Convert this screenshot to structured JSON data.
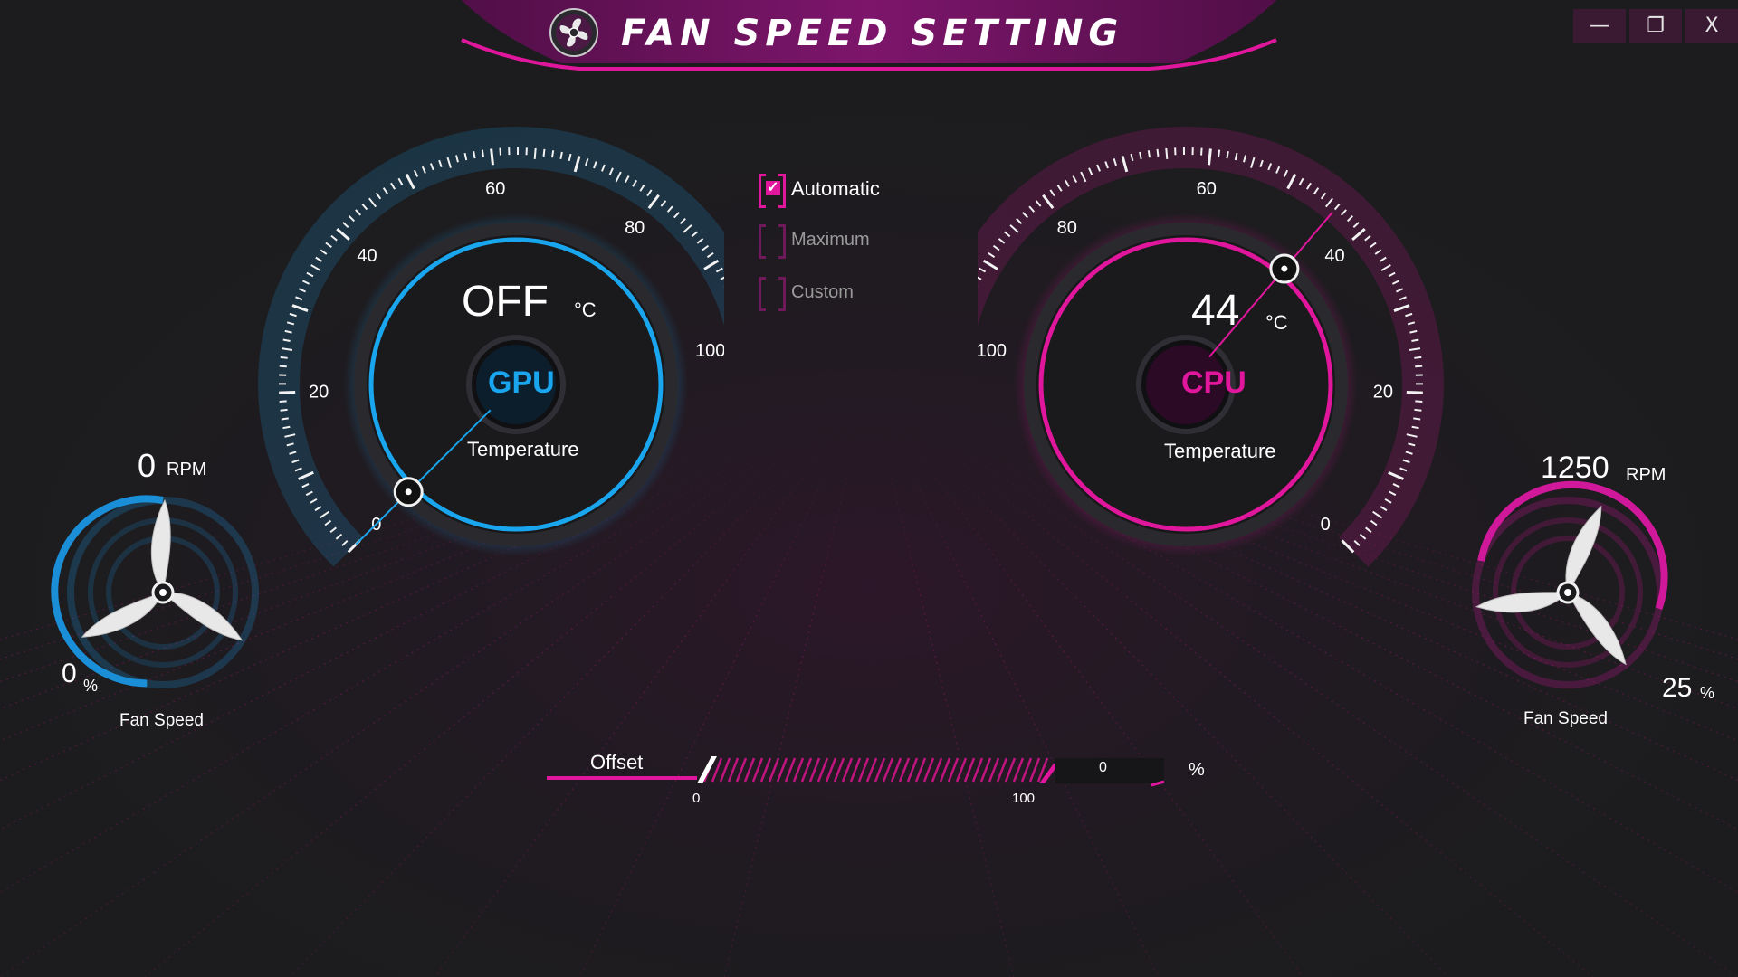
{
  "window": {
    "title": "FAN SPEED SETTING",
    "controls": {
      "minimize": "—",
      "restore": "❐",
      "close": "X"
    }
  },
  "gpu": {
    "temperature": "OFF",
    "unit": "°C",
    "badge": "GPU",
    "caption": "Temperature",
    "scale_labels": [
      "0",
      "20",
      "40",
      "60",
      "80",
      "100"
    ],
    "needle_value": 0,
    "color": "#1aa6ee"
  },
  "cpu": {
    "temperature": "44",
    "unit": "°C",
    "badge": "CPU",
    "caption": "Temperature",
    "scale_labels": [
      "0",
      "20",
      "40",
      "60",
      "80",
      "100"
    ],
    "needle_value": 44,
    "color": "#e0169c"
  },
  "gpu_fan": {
    "rpm": "0",
    "rpm_unit": "RPM",
    "percent": "0",
    "percent_unit": "%",
    "caption": "Fan Speed",
    "level": 0
  },
  "cpu_fan": {
    "rpm": "1250",
    "rpm_unit": "RPM",
    "percent": "25",
    "percent_unit": "%",
    "caption": "Fan Speed",
    "level": 0.25
  },
  "modes": [
    {
      "label": "Automatic",
      "checked": true
    },
    {
      "label": "Maximum",
      "checked": false
    },
    {
      "label": "Custom",
      "checked": false
    }
  ],
  "offset": {
    "label": "Offset",
    "value": "0",
    "unit": "%",
    "min_label": "0",
    "max_label": "100",
    "level": 0
  }
}
